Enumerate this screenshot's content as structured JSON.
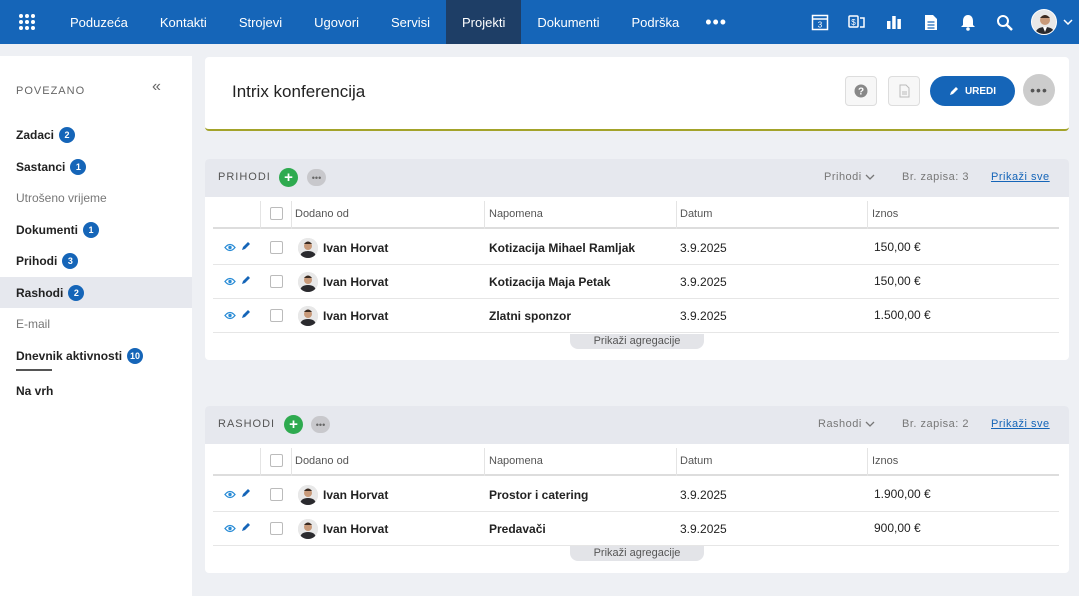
{
  "nav": {
    "items": [
      "Poduzeća",
      "Kontakti",
      "Strojevi",
      "Ugovori",
      "Servisi",
      "Projekti",
      "Dokumenti",
      "Podrška"
    ],
    "active_index": 5,
    "more": "•••",
    "calendar_day": "3"
  },
  "sidebar": {
    "title": "POVEZANO",
    "items": [
      {
        "label": "Zadaci",
        "badge": "2",
        "style": "bold"
      },
      {
        "label": "Sastanci",
        "badge": "1",
        "style": "bold"
      },
      {
        "label": "Utrošeno vrijeme",
        "badge": "",
        "style": "light"
      },
      {
        "label": "Dokumenti",
        "badge": "1",
        "style": "bold"
      },
      {
        "label": "Prihodi",
        "badge": "3",
        "style": "bold"
      },
      {
        "label": "Rashodi",
        "badge": "2",
        "style": "bold",
        "active": true
      },
      {
        "label": "E-mail",
        "badge": "",
        "style": "light"
      },
      {
        "label": "Dnevnik aktivnosti",
        "badge": "10",
        "style": "bold"
      },
      {
        "label": "Na vrh",
        "badge": "",
        "style": "bold"
      }
    ]
  },
  "header": {
    "title": "Intrix konferencija",
    "edit_label": "UREDI",
    "more": "•••"
  },
  "columns": [
    "Dodano od",
    "Napomena",
    "Datum",
    "Iznos"
  ],
  "income": {
    "title": "PRIHODI",
    "filter": "Prihodi",
    "count": "Br. zapisa: 3",
    "show_all": "Prikaži sve",
    "aggregate": "Prikaži agregacije",
    "rows": [
      {
        "user": "Ivan Horvat",
        "note": "Kotizacija Mihael Ramljak",
        "date": "3.9.2025",
        "amount": "150,00 €"
      },
      {
        "user": "Ivan Horvat",
        "note": "Kotizacija Maja Petak",
        "date": "3.9.2025",
        "amount": "150,00 €"
      },
      {
        "user": "Ivan Horvat",
        "note": "Zlatni sponzor",
        "date": "3.9.2025",
        "amount": "1.500,00 €"
      }
    ]
  },
  "expenses": {
    "title": "RASHODI",
    "filter": "Rashodi",
    "count": "Br. zapisa: 2",
    "show_all": "Prikaži sve",
    "aggregate": "Prikaži agregacije",
    "rows": [
      {
        "user": "Ivan Horvat",
        "note": "Prostor i catering",
        "date": "3.9.2025",
        "amount": "1.900,00 €"
      },
      {
        "user": "Ivan Horvat",
        "note": "Predavači",
        "date": "3.9.2025",
        "amount": "900,00 €"
      }
    ]
  },
  "colors": {
    "brand": "#1565b8",
    "nav_active": "#1e3e66",
    "add": "#2eaa4f",
    "accent_line": "#a3a32a"
  }
}
